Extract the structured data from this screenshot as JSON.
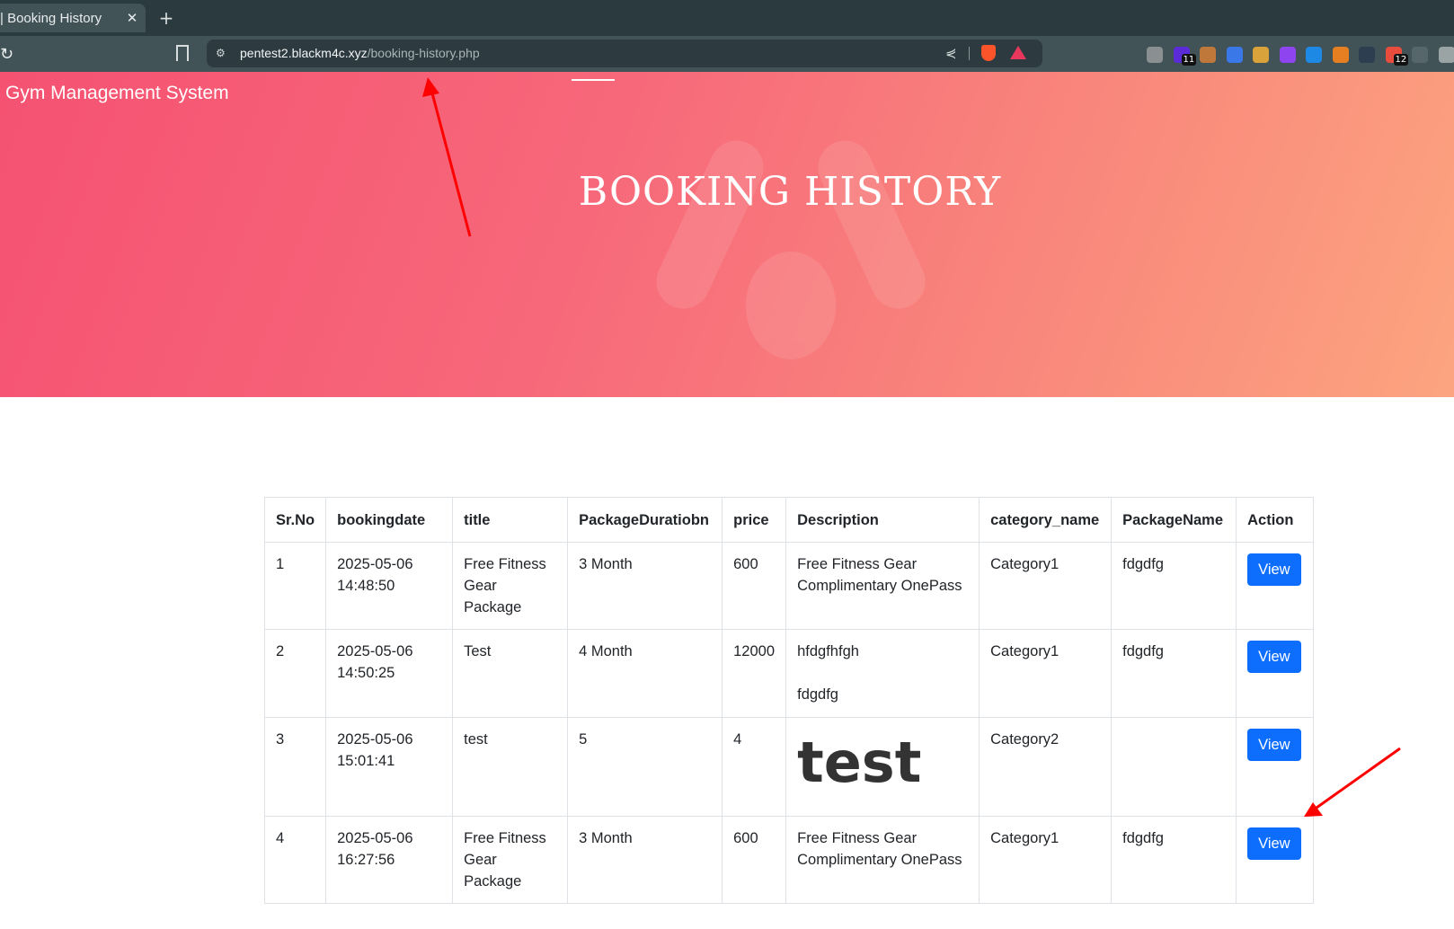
{
  "browser": {
    "tab_title": "| Booking History",
    "tab_close_icon": "close-icon",
    "new_tab_icon": "plus-icon",
    "url_domain": "pentest2.blackm4c.xyz",
    "url_path": "/booking-history.php",
    "extensions": [
      {
        "name": "ext-owl-icon",
        "color": "#8a8f91",
        "badge": ""
      },
      {
        "name": "ext-cube-icon",
        "color": "#5b2bd8",
        "badge": "11"
      },
      {
        "name": "ext-cookie-icon",
        "color": "#c0783a",
        "badge": ""
      },
      {
        "name": "ext-translate-icon",
        "color": "#3b78e7",
        "badge": ""
      },
      {
        "name": "ext-bug-icon",
        "color": "#d9a23a",
        "badge": ""
      },
      {
        "name": "ext-flask-icon",
        "color": "#8e44ef",
        "badge": ""
      },
      {
        "name": "ext-globe-icon",
        "color": "#1e88e5",
        "badge": ""
      },
      {
        "name": "ext-person-icon",
        "color": "#e67e22",
        "badge": ""
      },
      {
        "name": "ext-hat-icon",
        "color": "#2c3e50",
        "badge": ""
      },
      {
        "name": "ext-dice-icon",
        "color": "#e74c3c",
        "badge": "12"
      },
      {
        "name": "ext-text-icon",
        "color": "#56666a",
        "badge": ""
      },
      {
        "name": "ext-puzzle-icon",
        "color": "#9aa4a4",
        "badge": ""
      }
    ]
  },
  "site": {
    "brand": "Gym Management System",
    "hero_title": "BOOKING HISTORY"
  },
  "table": {
    "headers": [
      "Sr.No",
      "bookingdate",
      "title",
      "PackageDuratiobn",
      "price",
      "Description",
      "category_name",
      "PackageName",
      "Action"
    ],
    "rows": [
      {
        "sr": "1",
        "date": "2025-05-06",
        "time": "14:48:50",
        "title_1": "Free Fitness",
        "title_2": "Gear Package",
        "duration": "3 Month",
        "price": "600",
        "desc_1": "Free Fitness Gear",
        "desc_2": "Complimentary OnePass",
        "category": "Category1",
        "package": "fdgdfg",
        "action": "View"
      },
      {
        "sr": "2",
        "date": "2025-05-06",
        "time": "14:50:25",
        "title_1": "Test",
        "title_2": "",
        "duration": "4 Month",
        "price": "12000",
        "desc_1": "hfdgfhfgh",
        "desc_2": "fdgdfg",
        "category": "Category1",
        "package": "fdgdfg",
        "action": "View"
      },
      {
        "sr": "3",
        "date": "2025-05-06",
        "time": "15:01:41",
        "title_1": "test",
        "title_2": "",
        "duration": "5",
        "price": "4",
        "desc_big": "test",
        "category": "Category2",
        "package": "",
        "action": "View"
      },
      {
        "sr": "4",
        "date": "2025-05-06",
        "time": "16:27:56",
        "title_1": "Free Fitness",
        "title_2": "Gear Package",
        "duration": "3 Month",
        "price": "600",
        "desc_1": "Free Fitness Gear",
        "desc_2": "Complimentary OnePass",
        "category": "Category1",
        "package": "fdgdfg",
        "action": "View"
      }
    ]
  },
  "annotations": {
    "arrow_color": "#ff0000"
  }
}
